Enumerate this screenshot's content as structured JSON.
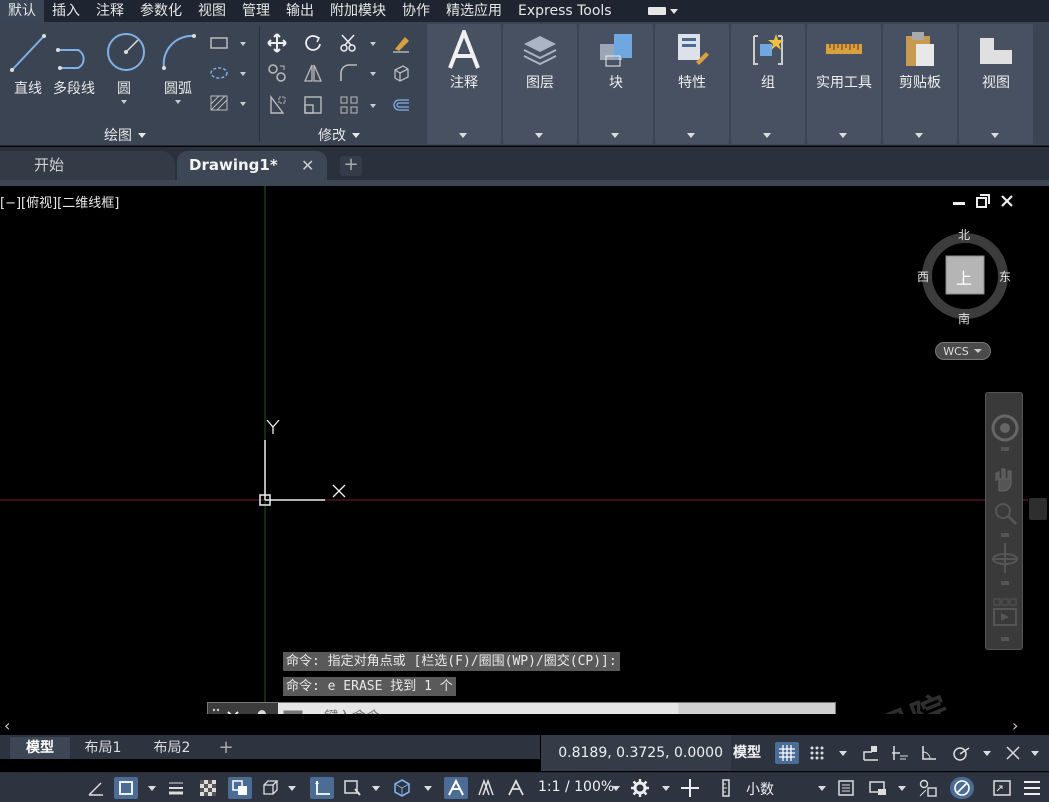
{
  "menu": {
    "items": [
      "默认",
      "插入",
      "注释",
      "参数化",
      "视图",
      "管理",
      "输出",
      "附加模块",
      "协作",
      "精选应用",
      "Express Tools"
    ],
    "active_index": 0
  },
  "ribbon": {
    "draw_tools": {
      "line": "直线",
      "polyline": "多段线",
      "circle": "圆",
      "arc": "圆弧"
    },
    "draw_panel_title": "绘图",
    "modify_panel_title": "修改",
    "groups": [
      "注释",
      "图层",
      "块",
      "特性",
      "组",
      "实用工具",
      "剪贴板",
      "视图"
    ]
  },
  "tabs": {
    "start": "开始",
    "drawing": "Drawing1*",
    "close": "✕",
    "add": "+"
  },
  "viewport": {
    "label": "[−][俯视][二维线框]",
    "axis_y": "Y",
    "axis_x": "X"
  },
  "viewcube": {
    "north": "北",
    "south": "南",
    "east": "东",
    "west": "西",
    "top": "上",
    "wcs": "WCS"
  },
  "watermark": "小小绘图院",
  "command": {
    "history": [
      "命令: 指定对角点或 [栏选(F)/圈围(WP)/圈交(CP)]:",
      "命令: e ERASE 找到 1 个"
    ],
    "placeholder": "键入命令"
  },
  "layouts": {
    "tabs": [
      "模型",
      "布局1",
      "布局2"
    ],
    "add": "+"
  },
  "status": {
    "coords": "0.8189, 0.3725, 0.0000",
    "model": "模型",
    "scale": "1:1 / 100%",
    "units": "小数"
  },
  "colors": {
    "accent": "#4b6c95",
    "ribbon": "#3b4453",
    "grid_x_axis": "#7a1f1f",
    "grid_y_axis": "#1f5a1f"
  }
}
